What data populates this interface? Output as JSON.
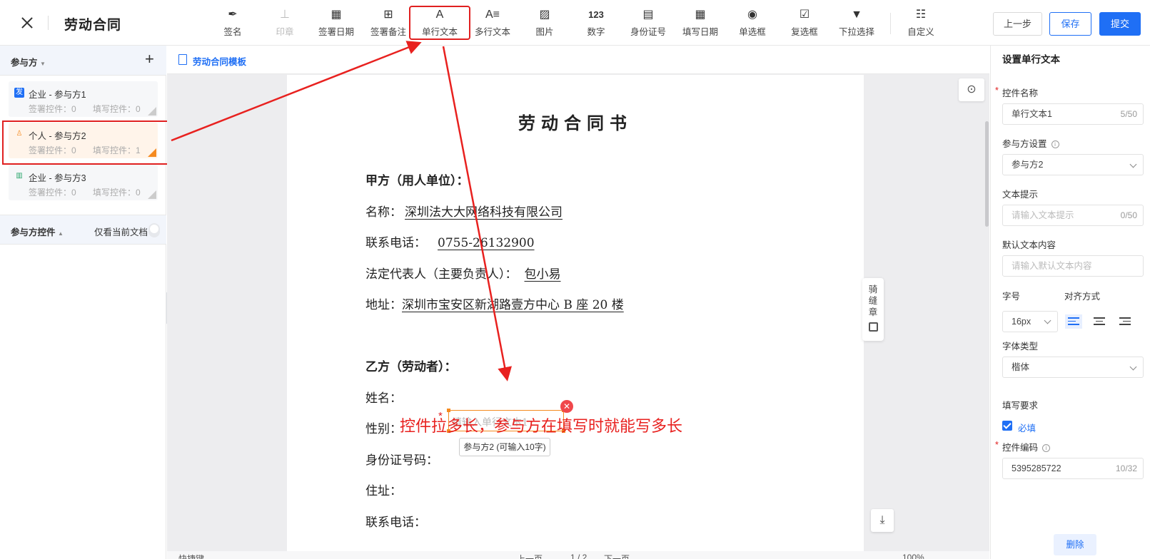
{
  "header": {
    "title": "劳动合同",
    "tools": [
      {
        "label": "签名",
        "icon": "pen-sign-icon",
        "glyph": "✒",
        "disabled": false
      },
      {
        "label": "印章",
        "icon": "stamp-icon",
        "glyph": "⊥",
        "disabled": true
      },
      {
        "label": "签署日期",
        "icon": "calendar-icon",
        "glyph": "▦",
        "disabled": false
      },
      {
        "label": "签署备注",
        "icon": "note-add-icon",
        "glyph": "⊞",
        "disabled": false
      },
      {
        "label": "单行文本",
        "icon": "single-text-icon",
        "glyph": "A",
        "disabled": false,
        "highlighted": true
      },
      {
        "label": "多行文本",
        "icon": "multi-text-icon",
        "glyph": "A≡",
        "disabled": false
      },
      {
        "label": "图片",
        "icon": "image-icon",
        "glyph": "▨",
        "disabled": false
      },
      {
        "label": "数字",
        "icon": "number-icon",
        "glyph": "123",
        "disabled": false
      },
      {
        "label": "身份证号",
        "icon": "id-card-icon",
        "glyph": "▤",
        "disabled": false
      },
      {
        "label": "填写日期",
        "icon": "fill-date-icon",
        "glyph": "▦",
        "disabled": false
      },
      {
        "label": "单选框",
        "icon": "radio-icon",
        "glyph": "◉",
        "disabled": false
      },
      {
        "label": "复选框",
        "icon": "checkbox-icon",
        "glyph": "☑",
        "disabled": false
      },
      {
        "label": "下拉选择",
        "icon": "dropdown-icon",
        "glyph": "▼",
        "disabled": false
      },
      {
        "label": "自定义",
        "icon": "custom-icon",
        "glyph": "☷",
        "disabled": false
      }
    ],
    "prev_label": "上一步",
    "save_label": "保存",
    "submit_label": "提交"
  },
  "sidebar": {
    "parties_title": "参与方",
    "parties": [
      {
        "badge": "发",
        "name": "企业 - 参与方1",
        "sign": "签署控件：0",
        "fill": "填写控件：0",
        "active": false
      },
      {
        "badge": "♙",
        "name": "个人 - 参与方2",
        "sign": "签署控件：0",
        "fill": "填写控件：1",
        "active": true
      },
      {
        "badge": "▥",
        "name": "企业 - 参与方3",
        "sign": "签署控件：0",
        "fill": "填写控件：0",
        "active": false
      }
    ],
    "controls_title": "参与方控件",
    "only_current": "仅看当前文档"
  },
  "doc": {
    "tab": "劳动合同模板",
    "title": "劳动合同书",
    "partyA": "甲方（用人单位）：",
    "name_label": "名称：",
    "name_value": "深圳法大大网络科技有限公司",
    "phone_label": "联系电话：",
    "phone_value": "0755-26132900",
    "rep_label": "法定代表人（主要负责人）：",
    "rep_value": "包小易",
    "addr_label": "地址：",
    "addr_value": "深圳市宝安区新湖路壹方中心 B 座 20 楼",
    "partyB": "乙方（劳动者）：",
    "b_name": "姓名：",
    "b_gender": "性别：",
    "b_id": "身份证号码：",
    "b_addr": "住址：",
    "b_phone": "联系电话：",
    "field_placeholder": "请输入单行文本1",
    "field_tip": "参与方2 (可输入10字)",
    "annotation": "控件拉多长，参与方在填写时就能写多长",
    "seam": "骑缝章",
    "bottom_shortcut": "快捷键",
    "bottom_prev": "上一页",
    "bottom_page": "1 / 2",
    "bottom_next": "下一页",
    "bottom_zoom": "100%"
  },
  "panel": {
    "title": "设置单行文本",
    "name_label": "控件名称",
    "name_value": "单行文本1",
    "name_count": "5/50",
    "party_label": "参与方设置",
    "party_value": "参与方2",
    "hint_label": "文本提示",
    "hint_placeholder": "请输入文本提示",
    "hint_count": "0/50",
    "default_label": "默认文本内容",
    "default_placeholder": "请输入默认文本内容",
    "size_label": "字号",
    "size_value": "16px",
    "align_label": "对齐方式",
    "font_label": "字体类型",
    "font_value": "楷体",
    "req_label": "填写要求",
    "req_value": "必填",
    "code_label": "控件编码",
    "code_value": "5395285722",
    "code_count": "10/32",
    "delete_label": "删除"
  },
  "colors": {
    "accent": "#1f6ff5",
    "annotation": "#e8211f",
    "active_party": "#f58a1f"
  }
}
